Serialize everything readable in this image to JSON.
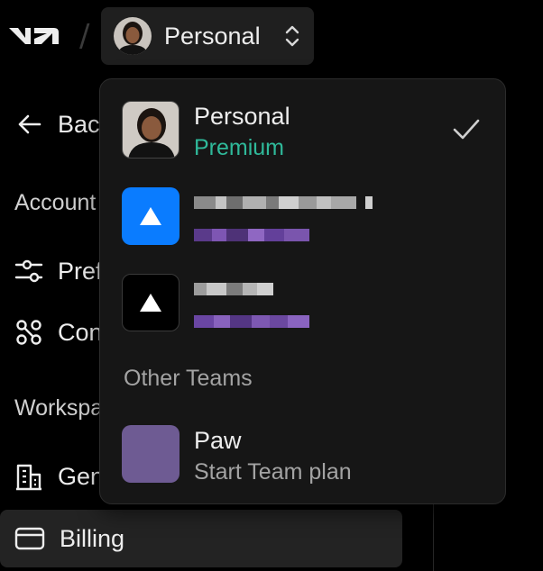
{
  "header": {
    "separator": "/",
    "scope_label": "Personal"
  },
  "sidebar": {
    "back_label": "Bac",
    "account_heading": "Account",
    "items": [
      {
        "label": "Pref"
      },
      {
        "label": "Con"
      }
    ],
    "workspace_heading": "Workspa",
    "workspace_items": [
      {
        "label": "Gen"
      },
      {
        "label": "Billing"
      }
    ]
  },
  "dropdown": {
    "personal": {
      "name": "Personal",
      "plan": "Premium"
    },
    "other_teams_label": "Other Teams",
    "team": {
      "name": "Paw",
      "action": "Start Team plan"
    }
  },
  "colors": {
    "premium": "#2fb99a",
    "blue_tile": "#0a7cff",
    "team_tile": "#6e5b93"
  }
}
